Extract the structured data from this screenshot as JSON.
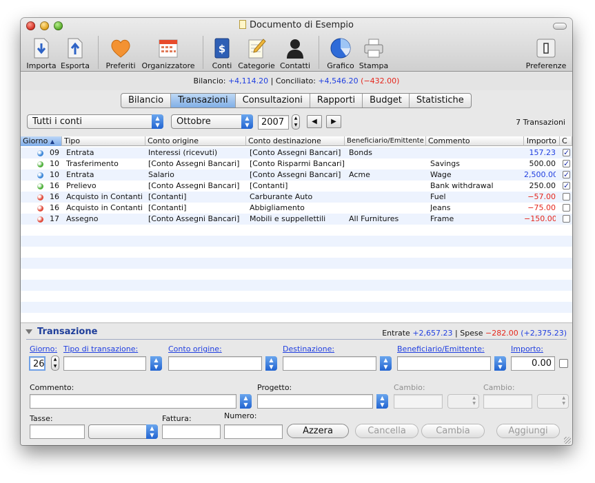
{
  "window": {
    "title": "Documento di Esempio"
  },
  "toolbar": {
    "items": [
      {
        "label": "Importa",
        "icon": "import-icon"
      },
      {
        "label": "Esporta",
        "icon": "export-icon"
      },
      {
        "label": "Preferiti",
        "icon": "heart-icon"
      },
      {
        "label": "Organizzatore",
        "icon": "calendar-icon"
      },
      {
        "label": "Conti",
        "icon": "accounts-book-icon"
      },
      {
        "label": "Categorie",
        "icon": "categories-icon"
      },
      {
        "label": "Contatti",
        "icon": "person-icon"
      },
      {
        "label": "Grafico",
        "icon": "pie-chart-icon"
      },
      {
        "label": "Stampa",
        "icon": "printer-icon"
      },
      {
        "label": "Preferenze",
        "icon": "preferences-icon"
      }
    ]
  },
  "info": {
    "balance_label": "Bilancio:",
    "balance": "+4,114.20",
    "sep": "|",
    "reconciled_label": "Conciliato:",
    "reconciled": "+4,546.20",
    "reconciled_diff": "(−432.00)"
  },
  "tabs": [
    "Bilancio",
    "Transazioni",
    "Consultazioni",
    "Rapporti",
    "Budget",
    "Statistiche"
  ],
  "filters": {
    "account": "Tutti i conti",
    "month": "Ottobre",
    "year": "2007",
    "prev": "◀",
    "next": "▶",
    "count": "7 Transazioni"
  },
  "table": {
    "headers": [
      "Giorno",
      "Tipo",
      "Conto origine",
      "Conto destinazione",
      "Beneficiario/Emittente",
      "Commento",
      "Importo",
      "C"
    ],
    "rows": [
      {
        "day": "09",
        "type": "Entrata",
        "from": "Interessi (ricevuti)",
        "to": "[Conto Assegni Bancari]",
        "payee": "Bonds",
        "comment": "",
        "amount": "157.23",
        "amount_color": "#1f3ee0",
        "dot": "#3a86d8",
        "checked": "✓"
      },
      {
        "day": "10",
        "type": "Trasferimento",
        "from": "[Conto Assegni Bancari]",
        "to": "[Conto Risparmi Bancari]",
        "payee": "",
        "comment": "Savings",
        "amount": "500.00",
        "amount_color": "#111111",
        "dot": "#4eb03a",
        "checked": "✓"
      },
      {
        "day": "10",
        "type": "Entrata",
        "from": "Salario",
        "to": "[Conto Assegni Bancari]",
        "payee": "Acme",
        "comment": "Wage",
        "amount": "2,500.00",
        "amount_color": "#1f3ee0",
        "dot": "#3a86d8",
        "checked": "✓"
      },
      {
        "day": "16",
        "type": "Prelievo",
        "from": "[Conto Assegni Bancari]",
        "to": "[Contanti]",
        "payee": "",
        "comment": "Bank withdrawal",
        "amount": "250.00",
        "amount_color": "#111111",
        "dot": "#4eb03a",
        "checked": "✓"
      },
      {
        "day": "16",
        "type": "Acquisto in Contanti",
        "from": "[Contanti]",
        "to": "Carburante Auto",
        "payee": "",
        "comment": "Fuel",
        "amount": "−57.00",
        "amount_color": "#e5261c",
        "dot": "#e04a3a",
        "checked": ""
      },
      {
        "day": "16",
        "type": "Acquisto in Contanti",
        "from": "[Contanti]",
        "to": "Abbigliamento",
        "payee": "",
        "comment": "Jeans",
        "amount": "−75.00",
        "amount_color": "#e5261c",
        "dot": "#e04a3a",
        "checked": ""
      },
      {
        "day": "17",
        "type": "Assegno",
        "from": "[Conto Assegni Bancari]",
        "to": "Mobili e suppellettili",
        "payee": "All Furnitures",
        "comment": "Frame",
        "amount": "−150.00",
        "amount_color": "#e5261c",
        "dot": "#e04a3a",
        "checked": ""
      }
    ]
  },
  "form": {
    "section_title": "Transazione",
    "income_label": "Entrate",
    "income": "+2,657.23",
    "sep": "|",
    "expense_label": "Spese",
    "expense": "−282.00",
    "net": "(+2,375.23)",
    "labels": {
      "day": "Giorno:",
      "type": "Tipo di transazione:",
      "from": "Conto origine:",
      "to": "Destinazione:",
      "payee": "Beneficiario/Emittente:",
      "amount": "Importo:",
      "comment": "Commento:",
      "project": "Progetto:",
      "rate1": "Cambio:",
      "rate2": "Cambio:",
      "tax": "Tasse:",
      "invoice": "Fattura:",
      "number": "Numero:"
    },
    "values": {
      "day": "26",
      "amount": "0.00"
    },
    "buttons": {
      "reset": "Azzera",
      "cancel": "Cancella",
      "change": "Cambia",
      "add": "Aggiungi"
    }
  }
}
